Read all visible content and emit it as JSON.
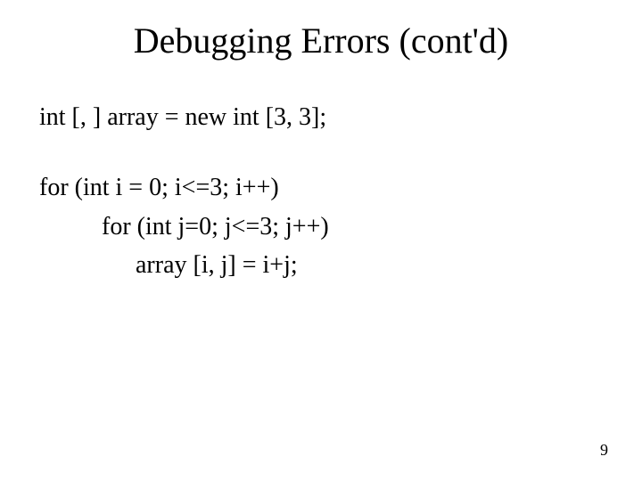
{
  "slide": {
    "title": "Debugging Errors (cont'd)",
    "code": {
      "line1": "int [, ] array = new int [3, 3];",
      "line2": "for (int i = 0; i<=3; i++)",
      "line3": "for (int j=0; j<=3; j++)",
      "line4": "array [i, j] = i+j;"
    },
    "page_number": "9"
  }
}
